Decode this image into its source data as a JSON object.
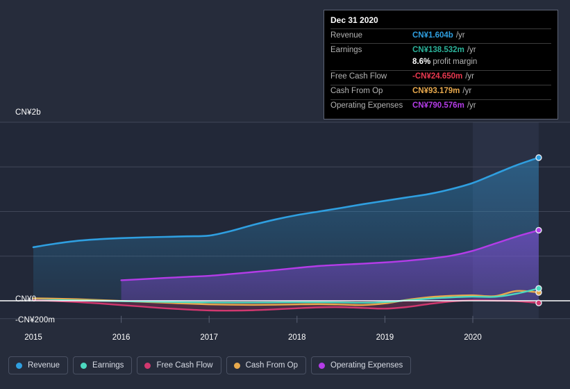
{
  "tooltip": {
    "date": "Dec 31 2020",
    "rows": [
      {
        "label": "Revenue",
        "value": "CN¥1.604b",
        "unit": "/yr",
        "color": "#2f9fe0"
      },
      {
        "label": "Earnings",
        "value": "CN¥138.532m",
        "unit": "/yr",
        "color": "#2bb39a"
      },
      {
        "label": "Free Cash Flow",
        "value": "-CN¥24.650m",
        "unit": "/yr",
        "color": "#e8384f"
      },
      {
        "label": "Cash From Op",
        "value": "CN¥93.179m",
        "unit": "/yr",
        "color": "#e8a94d"
      },
      {
        "label": "Operating Expenses",
        "value": "CN¥790.576m",
        "unit": "/yr",
        "color": "#b43ce8"
      }
    ],
    "margin_value": "8.6%",
    "margin_label": "profit margin"
  },
  "legend": {
    "items": [
      {
        "label": "Revenue",
        "color": "#2f9fe0"
      },
      {
        "label": "Earnings",
        "color": "#4cd9c0"
      },
      {
        "label": "Free Cash Flow",
        "color": "#d1386f"
      },
      {
        "label": "Cash From Op",
        "color": "#e8a94d"
      },
      {
        "label": "Operating Expenses",
        "color": "#b43ce8"
      }
    ]
  },
  "axes": {
    "y_top_label": "CN¥2b",
    "y_zero_label": "CN¥0",
    "y_bottom_label": "-CN¥200m",
    "x_labels": [
      "2015",
      "2016",
      "2017",
      "2018",
      "2019",
      "2020"
    ]
  },
  "chart_data": {
    "type": "area",
    "title": "",
    "xlabel": "",
    "ylabel": "CN¥",
    "currency": "CN¥",
    "grid": true,
    "legend_position": "bottom",
    "ylim": [
      -200000000,
      2000000000
    ],
    "yticks": [
      -200000000,
      0,
      500000000,
      1000000000,
      1500000000,
      2000000000
    ],
    "ytick_labels": [
      "-CN¥200m",
      "CN¥0",
      "",
      "",
      "",
      "CN¥2b"
    ],
    "xlim": [
      "2015",
      "2020.75"
    ],
    "xticks": [
      "2015",
      "2016",
      "2017",
      "2018",
      "2019",
      "2020"
    ],
    "highlight_band": {
      "from": "2020",
      "to": "2020.75",
      "note": "latest period"
    },
    "series": [
      {
        "name": "Revenue",
        "color": "#2f9fe0",
        "end_value": 1604000000,
        "x": [
          2015.0,
          2015.25,
          2015.5,
          2015.75,
          2016.0,
          2016.25,
          2016.5,
          2016.75,
          2017.0,
          2017.25,
          2017.5,
          2017.75,
          2018.0,
          2018.25,
          2018.5,
          2018.75,
          2019.0,
          2019.25,
          2019.5,
          2019.75,
          2020.0,
          2020.25,
          2020.5,
          2020.75
        ],
        "values": [
          600000000,
          640000000,
          672000000,
          690000000,
          702000000,
          710000000,
          716000000,
          722000000,
          730000000,
          782000000,
          850000000,
          910000000,
          960000000,
          1000000000,
          1040000000,
          1082000000,
          1120000000,
          1158000000,
          1196000000,
          1250000000,
          1320000000,
          1420000000,
          1520000000,
          1604000000
        ]
      },
      {
        "name": "Operating Expenses",
        "color": "#b43ce8",
        "end_value": 790576000,
        "x": [
          2016.0,
          2016.25,
          2016.5,
          2016.75,
          2017.0,
          2017.25,
          2017.5,
          2017.75,
          2018.0,
          2018.25,
          2018.5,
          2018.75,
          2019.0,
          2019.25,
          2019.5,
          2019.75,
          2020.0,
          2020.25,
          2020.5,
          2020.75
        ],
        "values": [
          230000000,
          243000000,
          256000000,
          268000000,
          280000000,
          300000000,
          322000000,
          344000000,
          368000000,
          390000000,
          404000000,
          416000000,
          430000000,
          448000000,
          472000000,
          504000000,
          560000000,
          640000000,
          720000000,
          790576000
        ]
      },
      {
        "name": "Cash From Op",
        "color": "#e8a94d",
        "end_value": 93179000,
        "x": [
          2015.0,
          2015.25,
          2015.5,
          2015.75,
          2016.0,
          2016.25,
          2016.5,
          2016.75,
          2017.0,
          2017.25,
          2017.5,
          2017.75,
          2018.0,
          2018.25,
          2018.5,
          2018.75,
          2019.0,
          2019.25,
          2019.5,
          2019.75,
          2020.0,
          2020.25,
          2020.5,
          2020.75
        ],
        "values": [
          28000000,
          24000000,
          18000000,
          8000000,
          -2000000,
          -12000000,
          -22000000,
          -32000000,
          -40000000,
          -44000000,
          -46000000,
          -44000000,
          -40000000,
          -38000000,
          -42000000,
          -48000000,
          -30000000,
          10000000,
          40000000,
          56000000,
          62000000,
          52000000,
          110000000,
          93179000
        ]
      },
      {
        "name": "Earnings",
        "color": "#4cd9c0",
        "end_value": 138532000,
        "x": [
          2015.0,
          2015.25,
          2015.5,
          2015.75,
          2016.0,
          2016.25,
          2016.5,
          2016.75,
          2017.0,
          2017.25,
          2017.5,
          2017.75,
          2018.0,
          2018.25,
          2018.5,
          2018.75,
          2019.0,
          2019.25,
          2019.5,
          2019.75,
          2020.0,
          2020.25,
          2020.5,
          2020.75
        ],
        "values": [
          10000000,
          8000000,
          4000000,
          0,
          -4000000,
          -8000000,
          -12000000,
          -16000000,
          -18000000,
          -20000000,
          -20000000,
          -18000000,
          -16000000,
          -16000000,
          -18000000,
          -22000000,
          -14000000,
          4000000,
          24000000,
          38000000,
          46000000,
          44000000,
          80000000,
          138532000
        ]
      },
      {
        "name": "Free Cash Flow",
        "color": "#d1386f",
        "end_value": -24650000,
        "x": [
          2015.0,
          2015.25,
          2015.5,
          2015.75,
          2016.0,
          2016.25,
          2016.5,
          2016.75,
          2017.0,
          2017.25,
          2017.5,
          2017.75,
          2018.0,
          2018.25,
          2018.5,
          2018.75,
          2019.0,
          2019.25,
          2019.5,
          2019.75,
          2020.0,
          2020.25,
          2020.5,
          2020.75
        ],
        "values": [
          6000000,
          -2000000,
          -14000000,
          -30000000,
          -48000000,
          -66000000,
          -84000000,
          -98000000,
          -108000000,
          -110000000,
          -106000000,
          -96000000,
          -84000000,
          -74000000,
          -72000000,
          -80000000,
          -88000000,
          -70000000,
          -36000000,
          -8000000,
          6000000,
          2000000,
          -4000000,
          -24650000
        ]
      }
    ]
  }
}
